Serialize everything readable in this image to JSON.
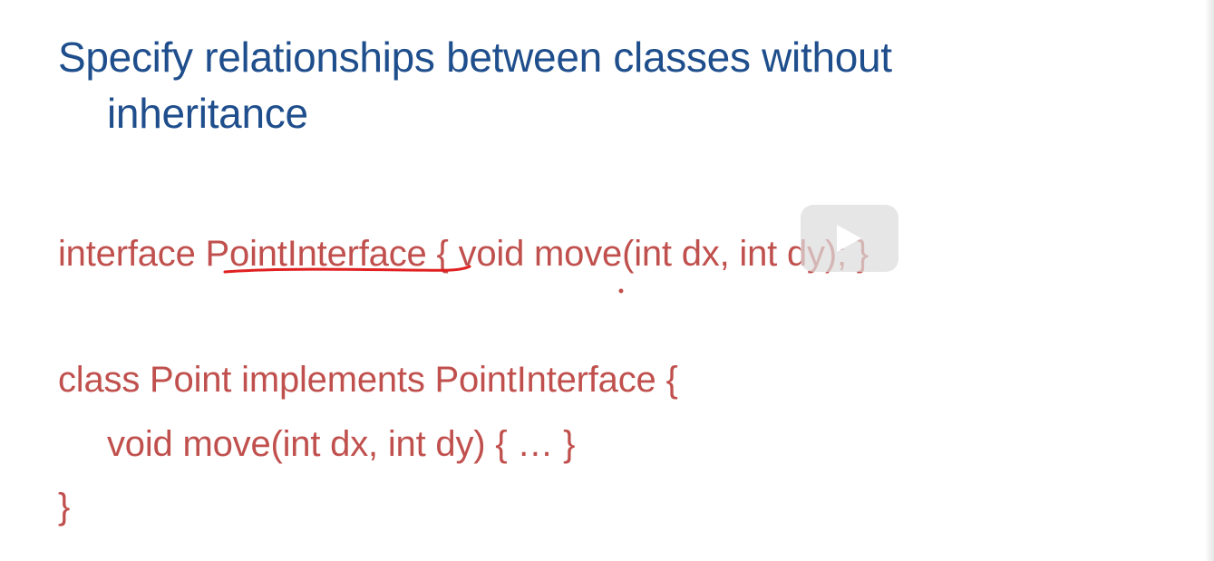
{
  "slide": {
    "title_line1": "Specify relationships between classes without",
    "title_line2": "inheritance",
    "code": {
      "interface_keyword": "interface ",
      "interface_name": "PointInterface",
      "interface_body": " { void move(int dx, int dy); }",
      "class_line": "class Point implements PointInterface {",
      "method_line": "void move(int dx, int dy) { … }",
      "close_line": "}"
    }
  },
  "overlay": {
    "play_icon": "play-icon"
  },
  "colors": {
    "title": "#1f4e8c",
    "code": "#c0504d",
    "annotation": "#e02020"
  }
}
